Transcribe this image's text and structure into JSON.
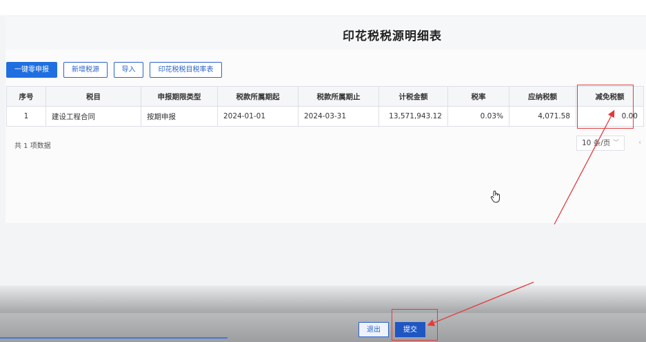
{
  "page": {
    "title": "印花税税源明细表"
  },
  "toolbar": {
    "zero_report": "一键零申报",
    "add_source": "新增税源",
    "import": "导入",
    "rate_table": "印花税税目税率表"
  },
  "table": {
    "headers": [
      "序号",
      "税目",
      "申报期限类型",
      "税款所属期起",
      "税款所属期止",
      "计税金额",
      "税率",
      "应纳税额",
      "减免税额"
    ],
    "rows": [
      [
        "1",
        "建设工程合同",
        "按期申报",
        "2024-01-01",
        "2024-03-31",
        "13,571,943.12",
        "0.03%",
        "4,071.58",
        "0.00"
      ]
    ]
  },
  "footer": {
    "total": "共 1 项数据",
    "page_size": "10 条/页"
  },
  "actions": {
    "exit": "退出",
    "submit": "提交"
  },
  "annotation_color": "#e23a3a",
  "accent_color": "#1f6fe0"
}
